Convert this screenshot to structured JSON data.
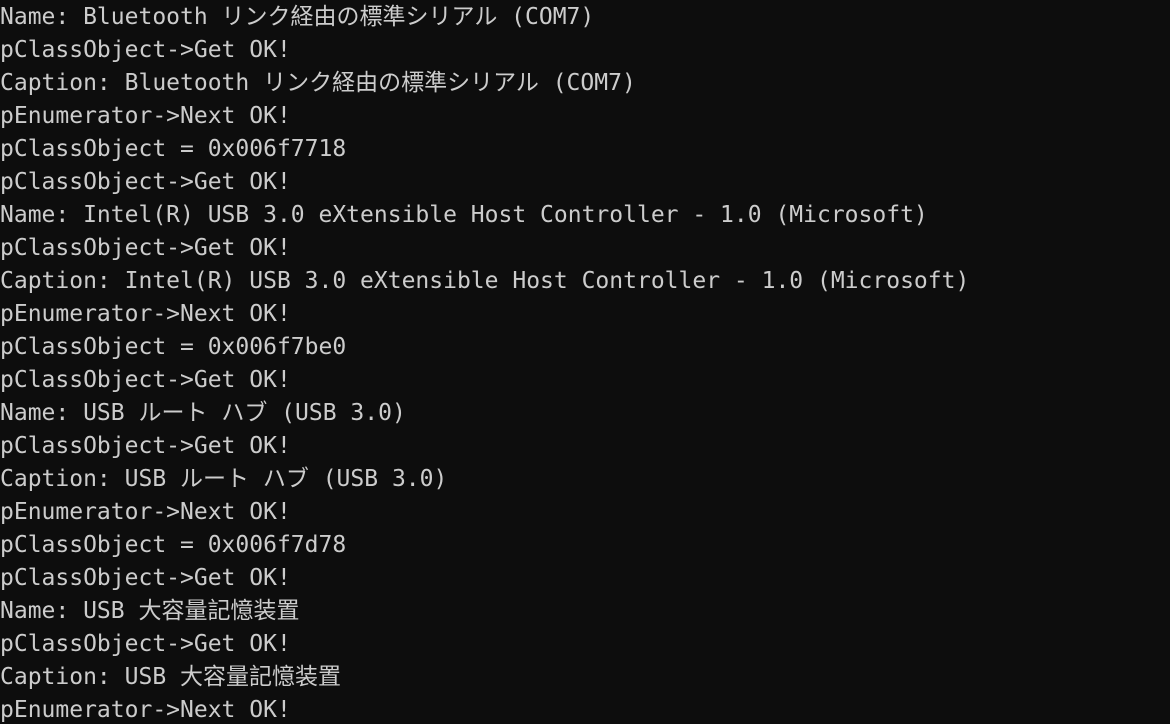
{
  "window": {
    "type": "console-terminal",
    "background_color": "#0d0d0d",
    "foreground_color": "#cccccc",
    "font_size_px": 23,
    "line_height_px": 33,
    "columns_visible": 73,
    "rows_visible": 22
  },
  "console": {
    "lines": [
      {
        "id": "line-01",
        "text": "Name: Bluetooth リンク経由の標準シリアル (COM7)"
      },
      {
        "id": "line-02",
        "text": "pClassObject->Get OK!"
      },
      {
        "id": "line-03",
        "text": "Caption: Bluetooth リンク経由の標準シリアル (COM7)"
      },
      {
        "id": "line-04",
        "text": "pEnumerator->Next OK!"
      },
      {
        "id": "line-05",
        "text": "pClassObject = 0x006f7718"
      },
      {
        "id": "line-06",
        "text": "pClassObject->Get OK!"
      },
      {
        "id": "line-07",
        "text": "Name: Intel(R) USB 3.0 eXtensible Host Controller - 1.0 (Microsoft)"
      },
      {
        "id": "line-08",
        "text": "pClassObject->Get OK!"
      },
      {
        "id": "line-09",
        "text": "Caption: Intel(R) USB 3.0 eXtensible Host Controller - 1.0 (Microsoft)"
      },
      {
        "id": "line-10",
        "text": "pEnumerator->Next OK!"
      },
      {
        "id": "line-11",
        "text": "pClassObject = 0x006f7be0"
      },
      {
        "id": "line-12",
        "text": "pClassObject->Get OK!"
      },
      {
        "id": "line-13",
        "text": "Name: USB ルート ハブ (USB 3.0)"
      },
      {
        "id": "line-14",
        "text": "pClassObject->Get OK!"
      },
      {
        "id": "line-15",
        "text": "Caption: USB ルート ハブ (USB 3.0)"
      },
      {
        "id": "line-16",
        "text": "pEnumerator->Next OK!"
      },
      {
        "id": "line-17",
        "text": "pClassObject = 0x006f7d78"
      },
      {
        "id": "line-18",
        "text": "pClassObject->Get OK!"
      },
      {
        "id": "line-19",
        "text": "Name: USB 大容量記憶装置"
      },
      {
        "id": "line-20",
        "text": "pClassObject->Get OK!"
      },
      {
        "id": "line-21",
        "text": "Caption: USB 大容量記憶装置"
      },
      {
        "id": "line-22",
        "text": "pEnumerator->Next OK!"
      }
    ]
  }
}
